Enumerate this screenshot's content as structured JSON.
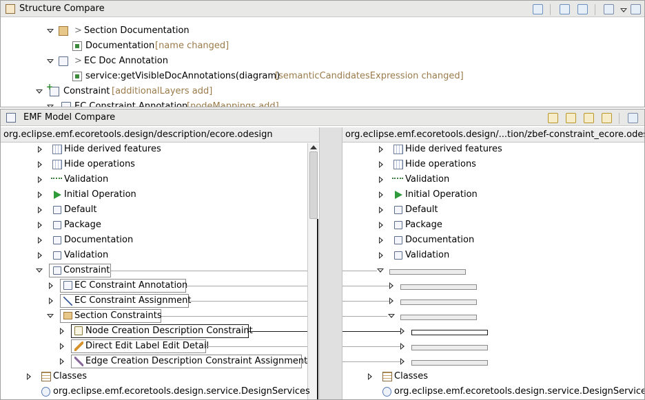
{
  "structure_panel": {
    "title": "Structure Compare",
    "rows": [
      {
        "prefix": "> ",
        "label": "Section Documentation",
        "note": ""
      },
      {
        "prefix": "",
        "label": "Documentation",
        "note": "[name changed]"
      },
      {
        "prefix": "> ",
        "label": "EC Doc Annotation",
        "note": ""
      },
      {
        "prefix": "",
        "label": "service:getVisibleDocAnnotations(diagram)",
        "note": "[semanticCandidatesExpression changed]"
      },
      {
        "prefix": "",
        "label": "Constraint",
        "note": "[additionalLayers add]"
      },
      {
        "prefix": "",
        "label": "EC Constraint Annotation",
        "note": "[nodeMappings add]"
      }
    ]
  },
  "model_panel": {
    "title": "EMF Model Compare",
    "left_path": "org.eclipse.emf.ecoretools.design/description/ecore.odesign",
    "right_path": "org.eclipse.emf.ecoretools.design/...tion/zbef-constraint_ecore.odesign",
    "left_rows": [
      "Hide derived features",
      "Hide operations",
      "Validation",
      "Initial Operation",
      "Default",
      "Package",
      "Documentation",
      "Validation",
      "Constraint",
      "EC Constraint Annotation",
      "EC Constraint Assignment",
      "Section Constraints",
      "Node Creation Description Constraint",
      "Direct Edit Label Edit Detail",
      "Edge Creation Description Constraint Assignment",
      "Classes",
      "org.eclipse.emf.ecoretools.design.service.DesignServices"
    ],
    "right_rows": [
      "Hide derived features",
      "Hide operations",
      "Validation",
      "Initial Operation",
      "Default",
      "Package",
      "Documentation",
      "Validation",
      "Classes",
      "org.eclipse.emf.ecoretools.design.service.DesignServices"
    ]
  },
  "colors": {
    "note_text": "#9a7b4a",
    "header_bg": "#e8e8e7",
    "connector": "#a8a8a8"
  },
  "icons": {
    "structure": "compare-structure-icon",
    "model": "emf-compare-icon"
  }
}
